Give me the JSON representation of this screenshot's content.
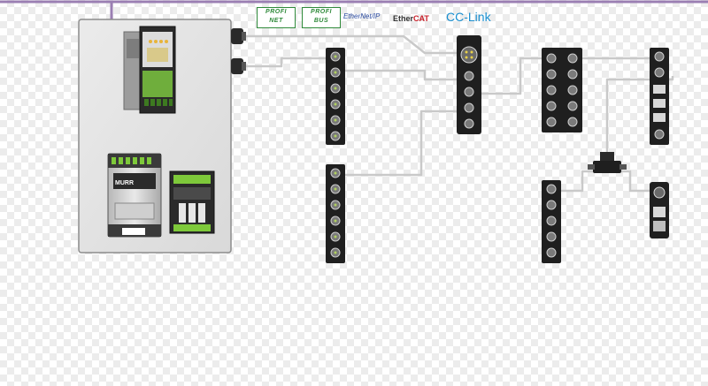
{
  "logos": {
    "profinet": [
      "PROFI",
      "NET"
    ],
    "profibus": [
      "PROFI",
      "BUS"
    ],
    "ethernetip": "EtherNet/IP",
    "ethercat_prefix": "Ether",
    "ethercat_suffix": "CAT",
    "cclink": "CC-Link"
  },
  "devices": {
    "power_supply_brand": "MURR"
  },
  "colors": {
    "bus_line": "#9b7fb3",
    "cable": "#c8c8c8",
    "cabinet": "#e4e4e4",
    "module_body": "#1f1f1f",
    "port_ring": "#8a8a8a",
    "led_green": "#7ec93a",
    "led_yellow": "#e8d04a"
  }
}
